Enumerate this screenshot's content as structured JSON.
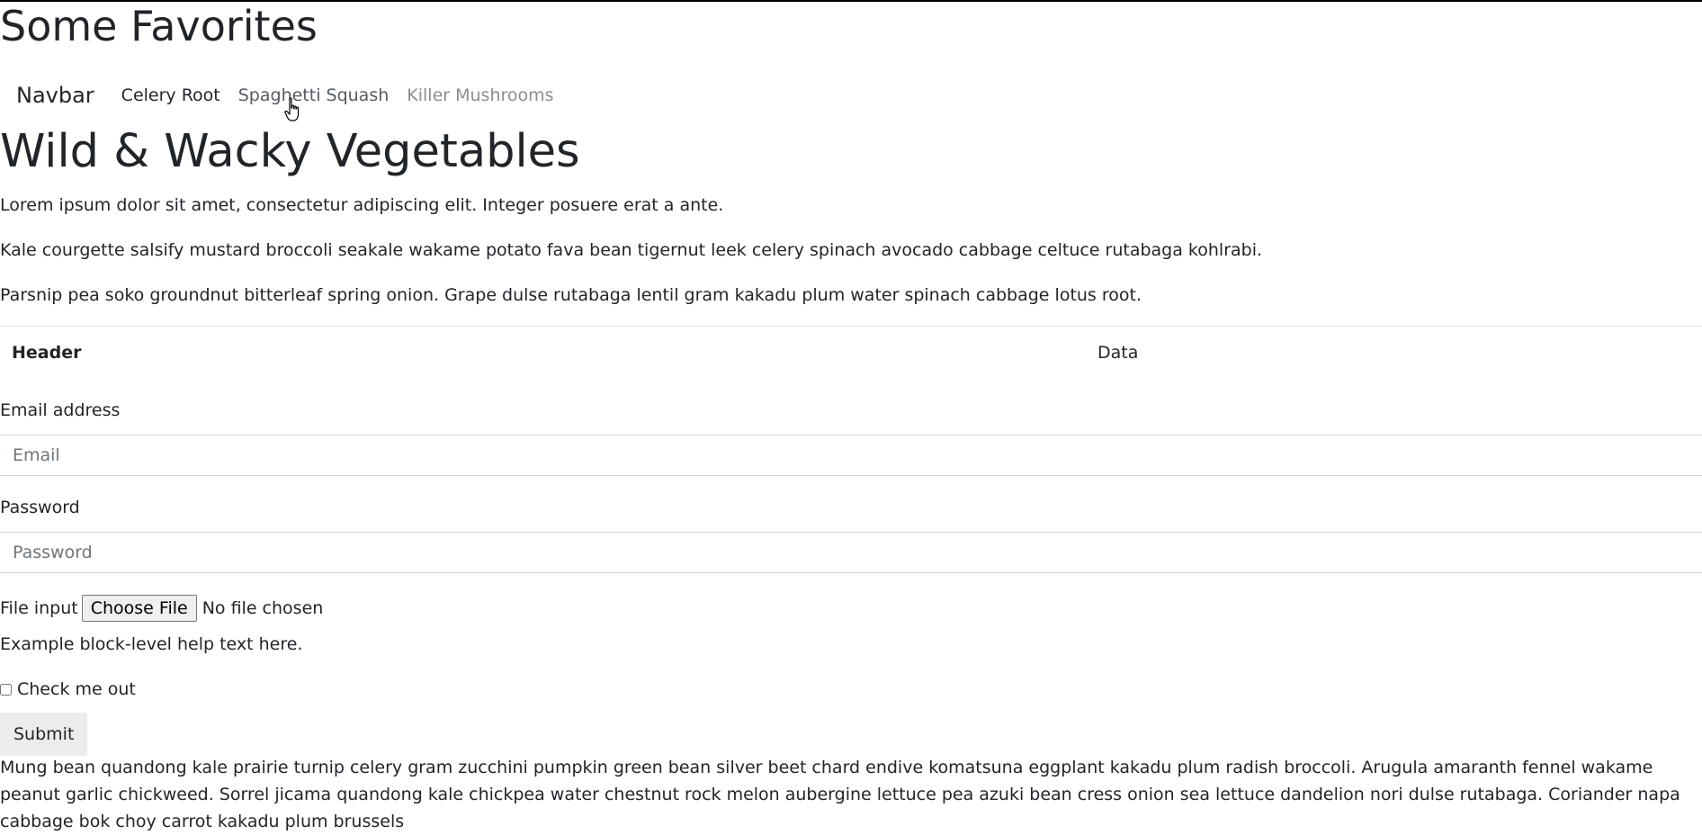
{
  "site": {
    "title": "Some Favorites"
  },
  "navbar": {
    "brand": "Navbar",
    "links": [
      {
        "label": "Celery Root",
        "state": "active"
      },
      {
        "label": "Spaghetti Squash",
        "state": "hover"
      },
      {
        "label": "Killer Mushrooms",
        "state": "disabled"
      }
    ]
  },
  "main": {
    "heading": "Wild & Wacky Vegetables",
    "paragraphs": [
      "Lorem ipsum dolor sit amet, consectetur adipiscing elit. Integer posuere erat a ante.",
      "Kale courgette salsify mustard broccoli seakale wakame potato fava bean tigernut leek celery spinach avocado cabbage celtuce rutabaga kohlrabi.",
      "Parsnip pea soko groundnut bitterleaf spring onion. Grape dulse rutabaga lentil gram kakadu plum water spinach cabbage lotus root."
    ]
  },
  "table": {
    "header": "Header",
    "data": "Data"
  },
  "form": {
    "email_label": "Email address",
    "email_placeholder": "Email",
    "password_label": "Password",
    "password_placeholder": "Password",
    "file_label": "File input",
    "file_button": "Choose File",
    "file_status": "No file chosen",
    "help_text": "Example block-level help text here.",
    "checkbox_label": "Check me out",
    "submit_label": "Submit"
  },
  "footer_text": "Mung bean quandong kale prairie turnip celery gram zucchini pumpkin green bean silver beet chard endive komatsuna eggplant kakadu plum radish broccoli. Arugula amaranth fennel wakame peanut garlic chickweed. Sorrel jicama quandong kale chickpea water chestnut rock melon aubergine lettuce pea azuki bean cress onion sea lettuce dandelion nori dulse rutabaga. Coriander napa cabbage bok choy carrot kakadu plum brussels",
  "colors": {
    "text": "#212529",
    "muted_link": "#555b62",
    "disabled_link": "#8a8f94",
    "border": "#dee2e6",
    "button_bg": "#ececec"
  },
  "icons": {
    "cursor": "hand-pointer-cursor-icon"
  }
}
